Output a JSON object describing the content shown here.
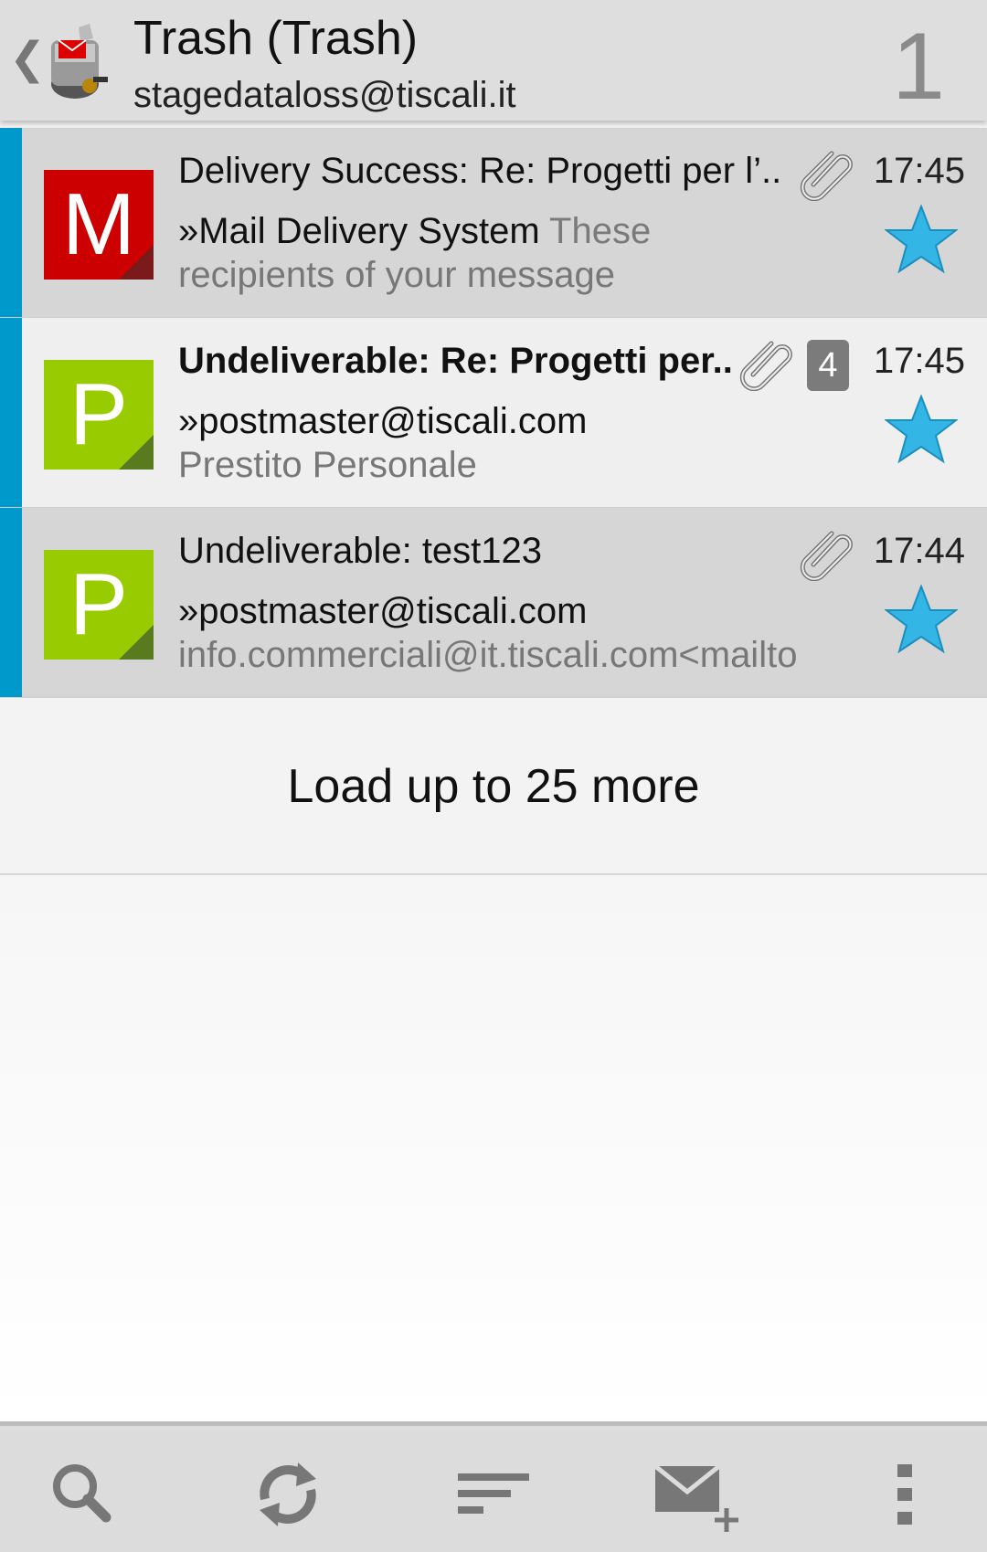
{
  "header": {
    "title": "Trash (Trash)",
    "account": "stagedataloss@tiscali.it",
    "unread_count": "1"
  },
  "messages": [
    {
      "avatar_letter": "M",
      "avatar_color": "#cc0000",
      "subject": "Delivery Success: Re: Progetti per l’..",
      "subject_bold": false,
      "sender": "»Mail Delivery System",
      "preview_inline": " These",
      "preview_line": "recipients of your message",
      "time": "17:45",
      "attachment_icon": "paperclip-icon",
      "thread_count": null,
      "starred": true
    },
    {
      "avatar_letter": "P",
      "avatar_color": "#99cc00",
      "subject": "Undeliverable: Re: Progetti per..",
      "subject_bold": true,
      "sender": "»postmaster@tiscali.com",
      "preview_inline": "",
      "preview_line": "Prestito Personale",
      "time": "17:45",
      "attachment_icon": "paperclip-icon",
      "thread_count": "4",
      "starred": true
    },
    {
      "avatar_letter": "P",
      "avatar_color": "#99cc00",
      "subject": "Undeliverable: test123",
      "subject_bold": false,
      "sender": "»postmaster@tiscali.com",
      "preview_inline": "",
      "preview_line": "info.commerciali@it.tiscali.com<mailto",
      "time": "17:44",
      "attachment_icon": "paperclip-icon",
      "thread_count": null,
      "starred": true
    }
  ],
  "load_more": "Load up to 25 more",
  "toolbar": {
    "icons": [
      "search-icon",
      "refresh-icon",
      "sort-icon",
      "compose-icon",
      "overflow-menu-icon"
    ]
  },
  "colors": {
    "accent": "#0099cc",
    "star": "#33b5e5"
  }
}
